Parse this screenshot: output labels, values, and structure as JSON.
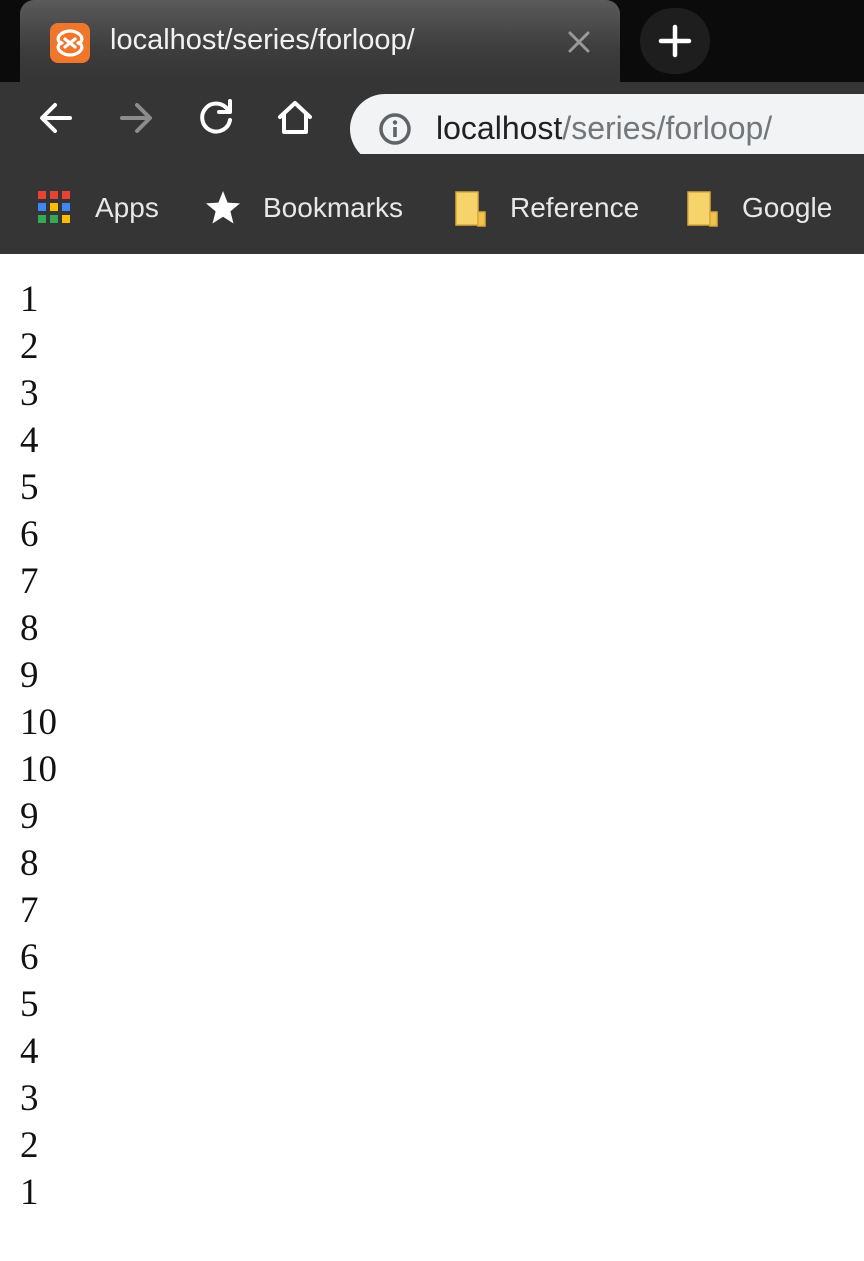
{
  "tab": {
    "title": "localhost/series/forloop/",
    "favicon": "xampp-icon"
  },
  "toolbar": {
    "back_icon": "back-arrow-icon",
    "forward_icon": "forward-arrow-icon",
    "reload_icon": "reload-icon",
    "home_icon": "home-icon",
    "url_host": "localhost",
    "url_path": "/series/forloop/"
  },
  "bookmarks": {
    "items": [
      {
        "label": "Apps",
        "icon": "apps-grid-icon"
      },
      {
        "label": "Bookmarks",
        "icon": "star-icon"
      },
      {
        "label": "Reference",
        "icon": "folder-icon"
      },
      {
        "label": "Google",
        "icon": "folder-icon"
      }
    ]
  },
  "page": {
    "lines": [
      "1",
      "2",
      "3",
      "4",
      "5",
      "6",
      "7",
      "8",
      "9",
      "10",
      "10",
      "9",
      "8",
      "7",
      "6",
      "5",
      "4",
      "3",
      "2",
      "1"
    ]
  },
  "colors": {
    "tabstrip_bg": "#0b0b0b",
    "toolbar_bg": "#353535",
    "omnibox_bg": "#f1f3f4",
    "favicon_orange": "#f0762b",
    "folder_yellow": "#f7d46b"
  }
}
